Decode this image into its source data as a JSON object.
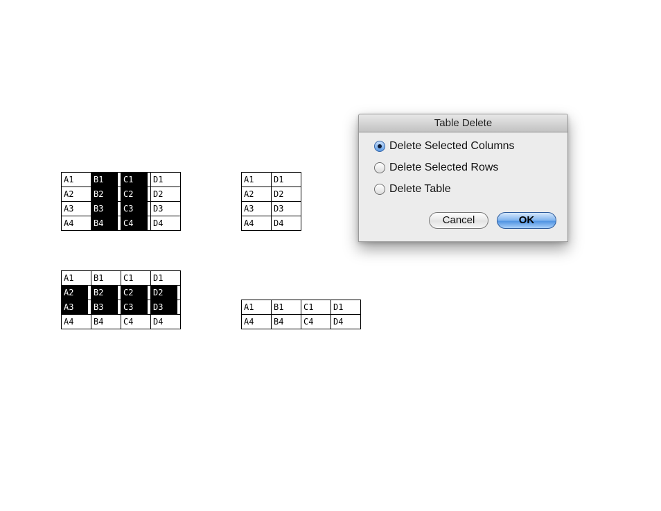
{
  "examples": {
    "delete_columns_before": {
      "rows": [
        [
          "A1",
          "B1",
          "C1",
          "D1"
        ],
        [
          "A2",
          "B2",
          "C2",
          "D2"
        ],
        [
          "A3",
          "B3",
          "C3",
          "D3"
        ],
        [
          "A4",
          "B4",
          "C4",
          "D4"
        ]
      ],
      "selected_columns": [
        1,
        2
      ]
    },
    "delete_columns_after": {
      "rows": [
        [
          "A1",
          "D1"
        ],
        [
          "A2",
          "D2"
        ],
        [
          "A3",
          "D3"
        ],
        [
          "A4",
          "D4"
        ]
      ]
    },
    "delete_rows_before": {
      "rows": [
        [
          "A1",
          "B1",
          "C1",
          "D1"
        ],
        [
          "A2",
          "B2",
          "C2",
          "D2"
        ],
        [
          "A3",
          "B3",
          "C3",
          "D3"
        ],
        [
          "A4",
          "B4",
          "C4",
          "D4"
        ]
      ],
      "selected_rows": [
        1,
        2
      ]
    },
    "delete_rows_after": {
      "rows": [
        [
          "A1",
          "B1",
          "C1",
          "D1"
        ],
        [
          "A4",
          "B4",
          "C4",
          "D4"
        ]
      ]
    }
  },
  "dialog": {
    "title": "Table Delete",
    "options": [
      {
        "label": "Delete Selected Columns",
        "checked": true
      },
      {
        "label": "Delete Selected Rows",
        "checked": false
      },
      {
        "label": "Delete Table",
        "checked": false
      }
    ],
    "cancel_label": "Cancel",
    "ok_label": "OK"
  },
  "colors": {
    "selection_background": "#000000",
    "selection_text": "#ffffff",
    "default_button": "#5b9ae4"
  }
}
